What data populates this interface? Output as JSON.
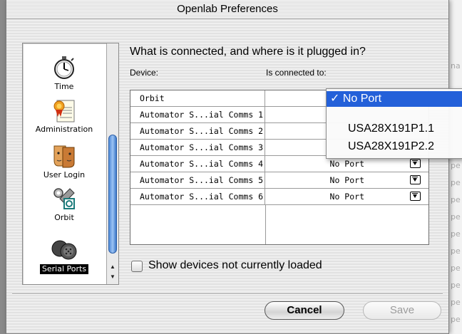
{
  "window": {
    "title": "Openlab Preferences"
  },
  "sidebar": {
    "items": [
      {
        "label": "Time",
        "icon": "stopwatch-icon"
      },
      {
        "label": "Administration",
        "icon": "certificate-icon"
      },
      {
        "label": "User Login",
        "icon": "user-faces-icon"
      },
      {
        "label": "Orbit",
        "icon": "tools-icon"
      },
      {
        "label": "Serial Ports",
        "icon": "serial-port-icon",
        "selected": true
      }
    ]
  },
  "panel": {
    "heading": "What is connected, and where is it plugged in?",
    "device_header": "Device:",
    "connected_header": "Is connected to:",
    "rows": [
      {
        "device": "Orbit",
        "port": ""
      },
      {
        "device": "Automator S...ial Comms 1",
        "port": ""
      },
      {
        "device": "Automator S...ial Comms 2",
        "port": ""
      },
      {
        "device": "Automator S...ial Comms 3",
        "port": ""
      },
      {
        "device": "Automator S...ial Comms 4",
        "port": "No Port"
      },
      {
        "device": "Automator S...ial Comms 5",
        "port": "No Port"
      },
      {
        "device": "Automator S...ial Comms 6",
        "port": "No Port"
      }
    ],
    "checkbox_label": "Show devices not currently loaded"
  },
  "menu": {
    "options": [
      {
        "label": "✓ No Port",
        "selected": true
      },
      {
        "label": "USA28X191P1.1"
      },
      {
        "label": "USA28X191P2.2"
      }
    ]
  },
  "buttons": {
    "cancel": "Cancel",
    "save": "Save"
  },
  "colors": {
    "selection": "#2360d9",
    "scroll_thumb": "#4f8ad7"
  }
}
